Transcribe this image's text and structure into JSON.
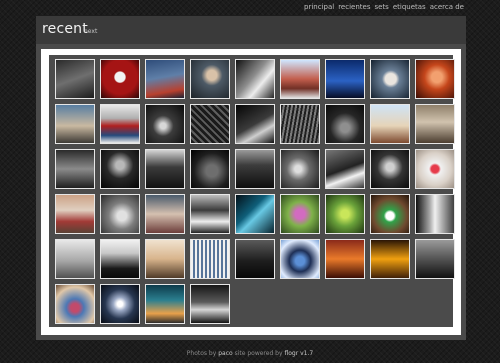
{
  "nav": {
    "items": [
      {
        "label": "principal"
      },
      {
        "label": "recientes"
      },
      {
        "label": "sets"
      },
      {
        "label": "etiquetas"
      },
      {
        "label": "acerca de"
      }
    ]
  },
  "header": {
    "title": "recent",
    "next_label": "next"
  },
  "gallery": {
    "columns": 9,
    "thumbnails": [
      {
        "background": "linear-gradient(160deg,#2b2b2b 0%,#6f6f6f 50%,#1b1b1b 100%)"
      },
      {
        "background": "radial-gradient(circle at 50% 45%,#f2f2f2 0 18%,#a51414 22% 60%,#2a0505 100%)"
      },
      {
        "background": "linear-gradient(170deg,#2f4d7a 0%,#5f7fa8 45%,#b8402e 80%,#1c2233 100%)"
      },
      {
        "background": "radial-gradient(circle at 55% 40%,#d9c2a8 0 16%,#4d5a66 34%,#1c2228 100%)"
      },
      {
        "background": "linear-gradient(130deg,#111 0%,#8d8d8d 45%,#ededed 65%,#242424 100%)"
      },
      {
        "background": "linear-gradient(180deg,#cfe6ff 0%,#c35e4d 50%,#713026 75%,#e0e0e0 100%)"
      },
      {
        "background": "linear-gradient(180deg,#0b2a6b 0%,#2b62c4 55%,#060d26 100%)"
      },
      {
        "background": "radial-gradient(circle at 52% 50%,#eae5df 0 20%,#6a7f96 32%,#14202e 100%)"
      },
      {
        "background": "radial-gradient(circle at 55% 45%,#f2a06f 0 18%,#c5461b 42%,#3a0d05 100%)"
      },
      {
        "background": "linear-gradient(180deg,#587ea1 0%,#c9b9a1 55%,#3d3a35 100%)"
      },
      {
        "background": "linear-gradient(180deg,#e8e8e8 0%,#b0b0b0 35%,#b01f1f 55%,#264a7c 80%,#ececec 100%)"
      },
      {
        "background": "radial-gradient(circle at 45% 55%,#d8d8d8 0 10%,#3c3c3c 35%,#0a0a0a 100%)"
      },
      {
        "background": "repeating-linear-gradient(45deg,#1a1a1a 0 3px,#5e5e5e 3px 5px)"
      },
      {
        "background": "linear-gradient(150deg,#050505 0%,#3b3b3b 50%,#cfcfcf 70%,#0d0d0d 100%)"
      },
      {
        "background": "repeating-linear-gradient(100deg,#1f1f1f 0 2px,#7a7a7a 2px 4px)"
      },
      {
        "background": "radial-gradient(circle at 50% 60%,#8f8f8f 0 15%,#262626 50%,#0b0b0b 100%)"
      },
      {
        "background": "linear-gradient(180deg,#cfe3f5 0%,#e6d4b8 55%,#7d4a2f 100%)"
      },
      {
        "background": "linear-gradient(180deg,#8e7f6a 0%,#d1c3ae 45%,#4b3d30 100%)"
      },
      {
        "background": "linear-gradient(180deg,#2a2a2a 0%,#8b8b8b 50%,#1f1f1f 100%)"
      },
      {
        "background": "radial-gradient(circle at 50% 40%,#b8b8b8 0 14%,#282828 45%,#050505 100%)"
      },
      {
        "background": "linear-gradient(180deg,#d5d5d5 0%,#3b3b3b 45%,#111 100%)"
      },
      {
        "background": "radial-gradient(circle at 55% 55%,#6e6e6e 0 20%,#1e1e1e 60%,#000 100%)"
      },
      {
        "background": "linear-gradient(180deg,#9a9a9a 0%,#3c3c3c 40%,#0e0e0e 100%)"
      },
      {
        "background": "radial-gradient(circle at 45% 50%,#dedede 0 12%,#6a6a6a 40%,#1b1b1b 100%)"
      },
      {
        "background": "linear-gradient(160deg,#777 0%,#222 50%,#f2f2f2 70%,#333 100%)"
      },
      {
        "background": "radial-gradient(circle at 50% 45%,#cfcfcf 0 14%,#343434 45%,#0a0a0a 100%)"
      },
      {
        "background": "radial-gradient(circle at 50% 50%,#e63b4b 0 14%,#f1f1f1 22%,#d9d0c7 60%,#9b8f84 100%)"
      },
      {
        "background": "linear-gradient(180deg,#cba286 0%,#e0cfc0 40%,#a23a36 70%,#5a4235 100%)"
      },
      {
        "background": "radial-gradient(circle at 55% 55%,#e1e1e1 0 16%,#7d7d7d 45%,#2a2a2a 100%)"
      },
      {
        "background": "linear-gradient(180deg,#4a5a6b 0%,#d5c0b0 50%,#6c3d3a 100%)"
      },
      {
        "background": "linear-gradient(180deg,#bdbdbd 0%,#3b3b3b 40%,#eeeeee 70%,#222 100%)"
      },
      {
        "background": "linear-gradient(135deg,#041018 0%,#0f5f7a 40%,#68c9e4 55%,#07222d 100%)"
      },
      {
        "background": "radial-gradient(circle at 50% 50%,#d26bc0 0 18%,#7fb24a 45%,#2f4a1e 100%)"
      },
      {
        "background": "radial-gradient(circle at 50% 50%,#c9e65a 0 15%,#6aa23a 45%,#1f3512 100%)"
      },
      {
        "background": "radial-gradient(circle at 50% 55%,#ffffff 0 14%,#31a34a 22%,#6f4a2f 60%,#231409 100%)"
      },
      {
        "background": "linear-gradient(90deg,#101010 0%,#a2a2a2 35%,#f0f0f0 50%,#3f3f3f 100%)"
      },
      {
        "background": "linear-gradient(180deg,#e8e8e8 0%,#a7a7a7 55%,#525252 100%)"
      },
      {
        "background": "linear-gradient(180deg,#f1f1f1 0%,#c7c7c7 35%,#191919 75%,#0a0a0a 100%)"
      },
      {
        "background": "linear-gradient(180deg,#f0e2cf 0%,#d8b48c 50%,#4f3a28 100%)"
      },
      {
        "background": "repeating-linear-gradient(90deg,#f1f1f1 0 2px,#56749a 2px 4px),linear-gradient(#0e1d2e,#0e1d2e)"
      },
      {
        "background": "linear-gradient(180deg,#5a5a5a 0%,#1e1e1e 55%,#070707 100%)"
      },
      {
        "background": "radial-gradient(circle at 50% 55%,#5b8fd6 0 16%,#1e2f55 38%,#e0ecff 75%,#7ca3d6 100%)"
      },
      {
        "background": "linear-gradient(180deg,#8a2a1a 0%,#ea7a2a 50%,#3b0d05 100%)"
      },
      {
        "background": "linear-gradient(180deg,#2a1505 0%,#f0a010 50%,#402008 100%)"
      },
      {
        "background": "linear-gradient(180deg,#9a9a9a 0%,#5a5a5a 45%,#101010 100%)"
      },
      {
        "background": "radial-gradient(circle at 50% 60%,#c24a6b 0 14%,#4c78b5 30%,#e0c7a8 70%,#6a4d36 100%)"
      },
      {
        "background": "radial-gradient(circle at 50% 50%,#ffffff 0 10%,#9aa8c4 25%,#273650 55%,#070b13 100%)"
      },
      {
        "background": "linear-gradient(180deg,#0d3a4a 0%,#2b7f8f 40%,#e8a14b 75%,#2b2b2b 100%)"
      },
      {
        "background": "linear-gradient(180deg,#161616 0%,#5a5a5a 45%,#d6d6d6 65%,#111 100%)"
      }
    ]
  },
  "footer": {
    "prefix": "Photos by",
    "author": "paco",
    "middle": "site powered by",
    "engine": "flogr",
    "version": "v1.7"
  }
}
